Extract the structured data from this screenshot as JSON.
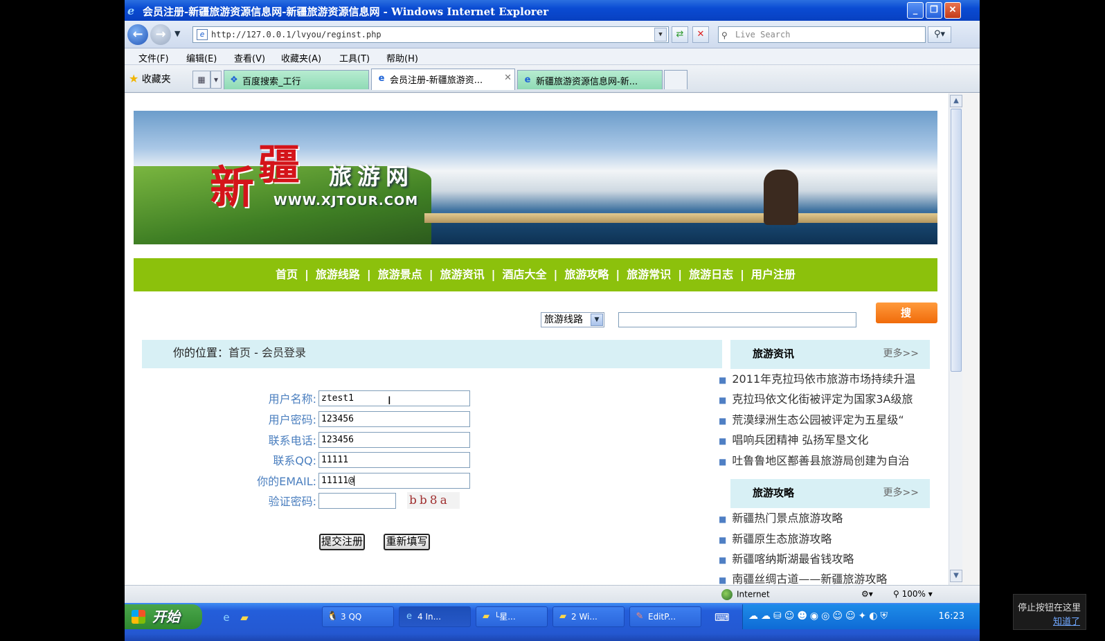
{
  "window": {
    "title": "会员注册-新疆旅游资源信息网-新疆旅游资源信息网 - Windows Internet Explorer",
    "min": "_",
    "max": "❐",
    "close": "✕"
  },
  "address": {
    "url": "http://127.0.0.1/lvyou/reginst.php",
    "search_placeholder": "Live Search"
  },
  "menu": [
    "文件(F)",
    "编辑(E)",
    "查看(V)",
    "收藏夹(A)",
    "工具(T)",
    "帮助(H)"
  ],
  "favorites_label": "收藏夹",
  "tabs": [
    {
      "label": "百度搜索_工行"
    },
    {
      "label": "会员注册-新疆旅游资..."
    },
    {
      "label": "新疆旅游资源信息网-新..."
    }
  ],
  "banner": {
    "logo_xin": "新",
    "logo_jiang": "疆",
    "site_name": "旅游网",
    "site_url": "WWW.XJTOUR.COM"
  },
  "nav": [
    "首页",
    "旅游线路",
    "旅游景点",
    "旅游资讯",
    "酒店大全",
    "旅游攻略",
    "旅游常识",
    "旅游日志",
    "用户注册"
  ],
  "search": {
    "category": "旅游线路",
    "button": "搜 索"
  },
  "breadcrumb": {
    "prefix": "你的位置：",
    "home": "首页",
    "sep": " - ",
    "current": "会员登录"
  },
  "form": {
    "username_label": "用户名称:",
    "username_value": "ztest1",
    "password_label": "用户密码:",
    "password_value": "123456",
    "phone_label": "联系电话:",
    "phone_value": "123456",
    "qq_label": "联系QQ:",
    "qq_value": "11111",
    "email_label": "你的EMAIL:",
    "email_value": "11111@",
    "captcha_label": "验证密码:",
    "captcha_value": "",
    "captcha_image_text": "bb8a",
    "submit": "提交注册",
    "reset": "重新填写"
  },
  "sidebar": {
    "news_title": "旅游资讯",
    "news_more": "更多>>",
    "news": [
      "2011年克拉玛依市旅游市场持续升温",
      "克拉玛依文化街被评定为国家3A级旅",
      "荒漠绿洲生态公园被评定为五星级“",
      "唱响兵团精神 弘扬军垦文化",
      "吐鲁鲁地区鄯善县旅游局创建为自治"
    ],
    "guide_title": "旅游攻略",
    "guide_more": "更多>>",
    "guides": [
      "新疆热门景点旅游攻略",
      "新疆原生态旅游攻略",
      "新疆喀纳斯湖最省钱攻略",
      "南疆丝绸古道——新疆旅游攻略"
    ]
  },
  "status": {
    "zone": "Internet",
    "zoom": "100%"
  },
  "taskbar": {
    "start": "开始",
    "tasks": [
      "3 QQ",
      "4 In...",
      "└星...",
      "2 Wi...",
      "EditP..."
    ],
    "clock": "16:23"
  },
  "notice": {
    "text": "停止按钮在这里",
    "ok": "知道了"
  }
}
